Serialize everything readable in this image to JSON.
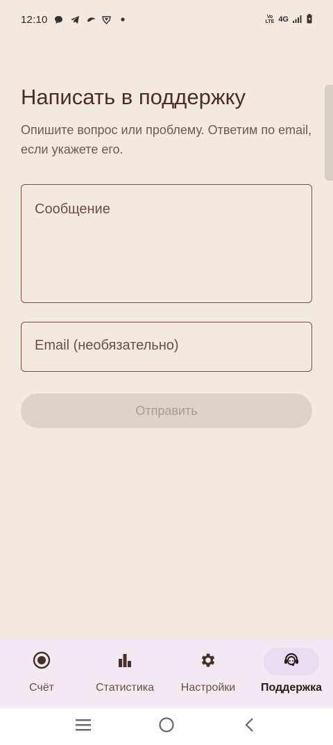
{
  "status_bar": {
    "time": "12:10",
    "icons_left": [
      "chat-bubble-icon",
      "telegram-icon",
      "cloud-icon",
      "vpn-shield-icon",
      "dot-icon"
    ],
    "volte": "VoLTE",
    "network": "4G",
    "icons_right": [
      "signal-icon",
      "battery-icon"
    ]
  },
  "page": {
    "title": "Написать в поддержку",
    "subtitle": "Опишите вопрос или проблему. Ответим по email, если укажете его."
  },
  "form": {
    "message_placeholder": "Сообщение",
    "email_placeholder": "Email (необязательно)",
    "send_label": "Отправить"
  },
  "bottom_nav": {
    "items": [
      {
        "label": "Счёт",
        "icon": "radio-target-icon",
        "active": false
      },
      {
        "label": "Статистика",
        "icon": "bar-chart-icon",
        "active": false
      },
      {
        "label": "Настройки",
        "icon": "gear-icon",
        "active": false
      },
      {
        "label": "Поддержка",
        "icon": "support-agent-icon",
        "active": true
      }
    ]
  },
  "system_nav": {
    "icons": [
      "recent-apps-icon",
      "home-icon",
      "back-icon"
    ]
  },
  "colors": {
    "background": "#F3E9DF",
    "accent": "#4A2E27",
    "field_border": "#7A4A40",
    "button_disabled_bg": "#DED3C8",
    "nav_background": "#F2EAF3",
    "nav_active_pill": "#E8DDF2"
  }
}
